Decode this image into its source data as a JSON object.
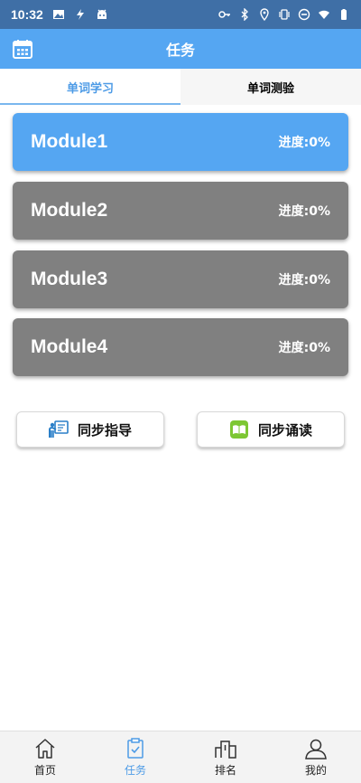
{
  "status_bar": {
    "time": "10:32"
  },
  "app_bar": {
    "title": "任务"
  },
  "tabs": [
    {
      "label": "单词学习",
      "active": true
    },
    {
      "label": "单词测验",
      "active": false
    }
  ],
  "modules": [
    {
      "name": "Module1",
      "progress": "进度:0%",
      "state": "active"
    },
    {
      "name": "Module2",
      "progress": "进度:0%",
      "state": "locked"
    },
    {
      "name": "Module3",
      "progress": "进度:0%",
      "state": "locked"
    },
    {
      "name": "Module4",
      "progress": "进度:0%",
      "state": "locked"
    }
  ],
  "actions": {
    "guide_label": "同步指导",
    "read_label": "同步诵读"
  },
  "bottom_nav": [
    {
      "label": "首页",
      "icon": "home-icon"
    },
    {
      "label": "任务",
      "icon": "task-icon",
      "active": true
    },
    {
      "label": "排名",
      "icon": "ranking-icon"
    },
    {
      "label": "我的",
      "icon": "profile-icon"
    }
  ],
  "colors": {
    "status_bar": "#3f6fa6",
    "primary": "#55a6f2",
    "module_locked": "#808080"
  }
}
